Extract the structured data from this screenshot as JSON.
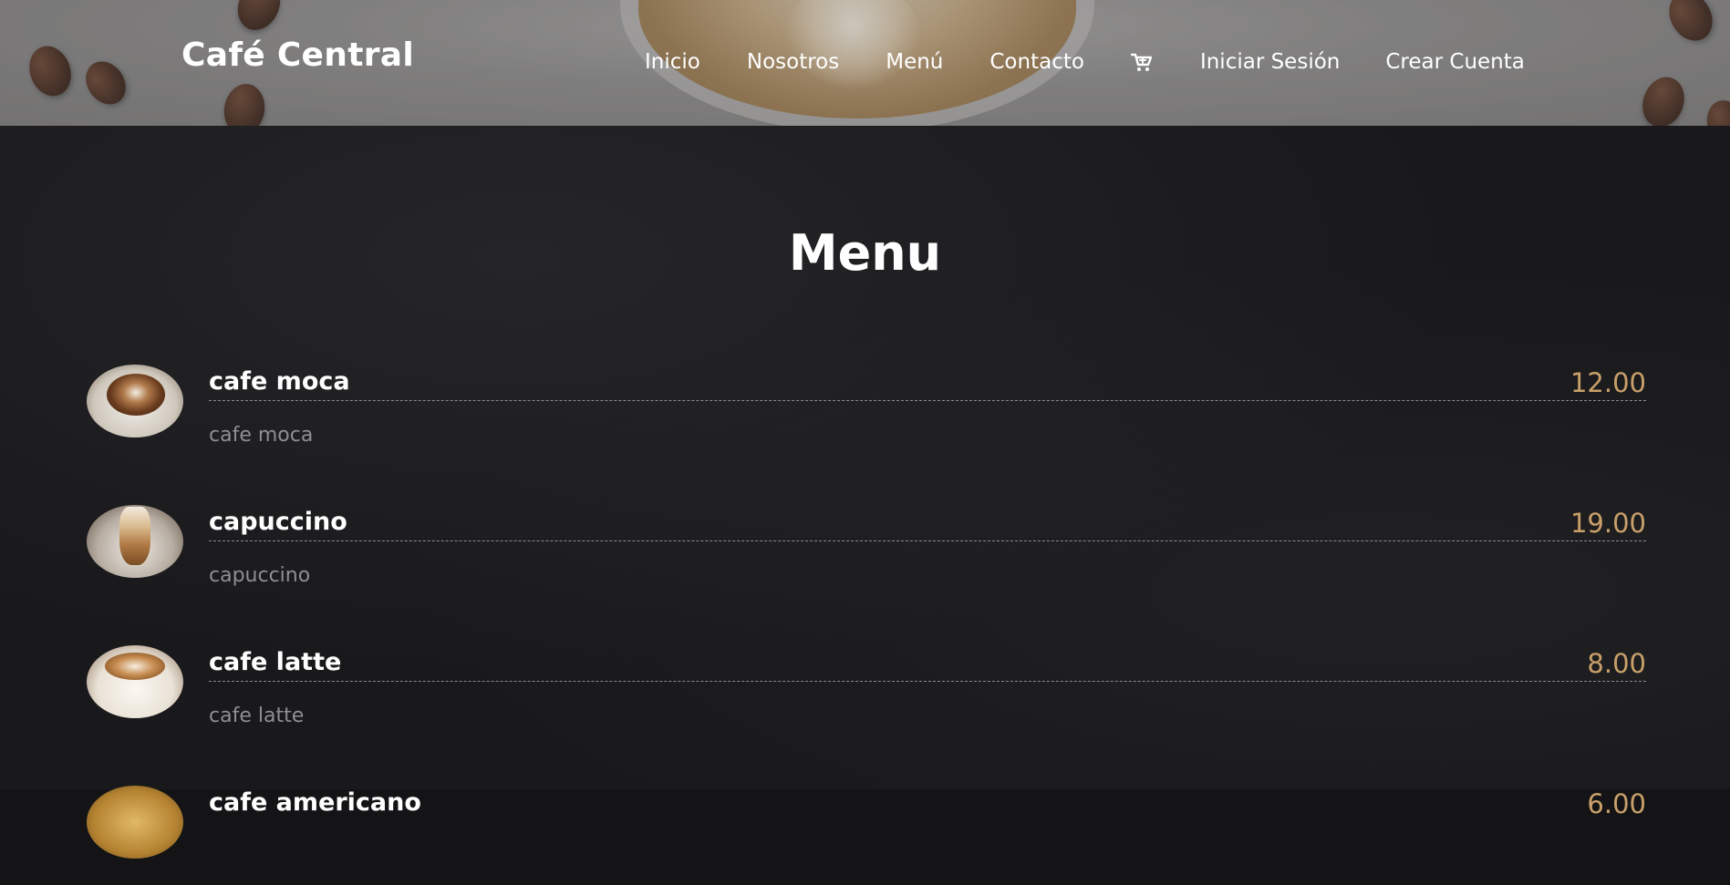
{
  "header": {
    "brand": "Café Central",
    "nav": {
      "inicio": "Inicio",
      "nosotros": "Nosotros",
      "menu": "Menú",
      "contacto": "Contacto",
      "cart_icon": "cart-icon",
      "login": "Iniciar Sesión",
      "signup": "Crear Cuenta"
    }
  },
  "menu": {
    "title": "Menu",
    "items": [
      {
        "name": "cafe moca",
        "description": "cafe moca",
        "price": "12.00",
        "image": "mocha-coffee"
      },
      {
        "name": "capuccino",
        "description": "capuccino",
        "price": "19.00",
        "image": "cappuccino-glass"
      },
      {
        "name": "cafe latte",
        "description": "cafe latte",
        "price": "8.00",
        "image": "latte-cup"
      },
      {
        "name": "cafe americano",
        "description": "",
        "price": "6.00",
        "image": "americano"
      }
    ]
  },
  "colors": {
    "price": "#c9a06a",
    "background": "#19191b",
    "text": "#ffffff",
    "muted": "#8f8f91"
  }
}
